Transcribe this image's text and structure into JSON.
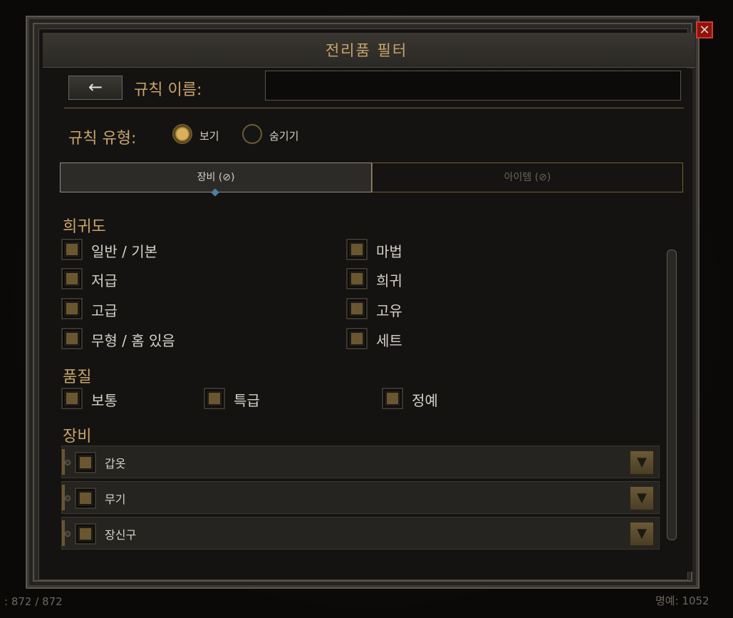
{
  "window": {
    "title": "전리품 필터",
    "close_glyph": "✕"
  },
  "background": {
    "left_text": ": 872 / 872",
    "right_text": "명예: 1052"
  },
  "rule": {
    "back_glyph": "←",
    "name_label": "규칙 이름:",
    "name_value": "",
    "type_label": "규칙 유형:",
    "type_options": [
      {
        "label": "보기",
        "selected": true
      },
      {
        "label": "숨기기",
        "selected": false
      }
    ]
  },
  "tabs": [
    {
      "label": "장비 (⊘)",
      "active": true
    },
    {
      "label": "아이템 (⊘)",
      "active": false
    }
  ],
  "rarity": {
    "title": "희귀도",
    "items": [
      "일반 / 기본",
      "마법",
      "저급",
      "희귀",
      "고급",
      "고유",
      "무형 / 홈 있음",
      "세트"
    ]
  },
  "quality": {
    "title": "품질",
    "items": [
      "보통",
      "특급",
      "정예"
    ]
  },
  "equipment": {
    "title": "장비",
    "items": [
      "갑옷",
      "무기",
      "장신구"
    ],
    "dropdown_glyph": "▼"
  },
  "colors": {
    "accent_gold": "#c8a66a",
    "close_red": "#8a1410"
  }
}
